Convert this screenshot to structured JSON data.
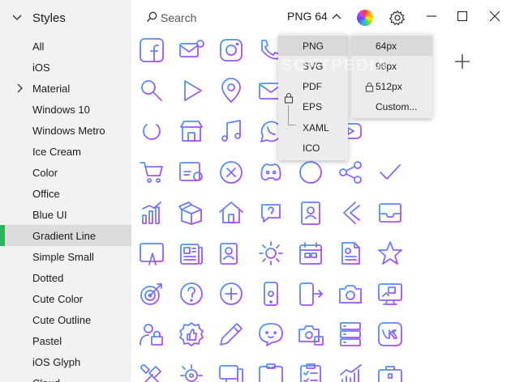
{
  "sidebar": {
    "header": "Styles",
    "items": [
      {
        "label": "All"
      },
      {
        "label": "iOS"
      },
      {
        "label": "Material",
        "expandable": true
      },
      {
        "label": "Windows 10"
      },
      {
        "label": "Windows Metro"
      },
      {
        "label": "Ice Cream"
      },
      {
        "label": "Color"
      },
      {
        "label": "Office"
      },
      {
        "label": "Blue UI"
      },
      {
        "label": "Gradient Line",
        "selected": true
      },
      {
        "label": "Simple Small"
      },
      {
        "label": "Dotted"
      },
      {
        "label": "Cute Color"
      },
      {
        "label": "Cute Outline"
      },
      {
        "label": "Pastel"
      },
      {
        "label": "iOS Glyph"
      },
      {
        "label": "Cloud"
      }
    ]
  },
  "toolbar": {
    "search_placeholder": "Search",
    "format_label": "PNG 64",
    "accent_selected": "#2fb35a"
  },
  "format_menu": {
    "items": [
      "PNG",
      "SVG",
      "PDF",
      "EPS",
      "XAML",
      "ICO"
    ],
    "selected": "PNG",
    "locked_items": [
      "PDF",
      "EPS",
      "XAML"
    ]
  },
  "size_menu": {
    "items": [
      "64px",
      "96px",
      "512px",
      "Custom..."
    ],
    "selected": "64px",
    "locked_items": [
      "512px"
    ]
  },
  "watermark": "SOFTPEDIA",
  "gradient": {
    "from": "#3aa0ff",
    "to": "#c13bff"
  },
  "icons": [
    [
      "facebook-icon",
      "email-icon",
      "instagram-icon",
      "phone-icon",
      "hidden",
      "hidden",
      "hidden"
    ],
    [
      "search-icon",
      "play-icon",
      "location-pin-icon",
      "mail-icon",
      "hidden",
      "hidden",
      "hidden"
    ],
    [
      "power-icon",
      "shop-icon",
      "music-note-icon",
      "whatsapp-icon",
      "hidden",
      "youtube-icon",
      "hidden"
    ],
    [
      "shopping-cart-icon",
      "web-settings-icon",
      "cancel-icon",
      "discord-icon",
      "circle-icon",
      "share-icon",
      "checkmark-icon"
    ],
    [
      "bar-chart-icon",
      "open-box-icon",
      "home-icon",
      "chat-question-icon",
      "id-badge-icon",
      "chevron-left-icon",
      "inbox-icon"
    ],
    [
      "web-design-icon",
      "news-icon",
      "contacts-icon",
      "gear-brain-icon",
      "calendar-icon",
      "document-icon",
      "star-icon"
    ],
    [
      "target-icon",
      "help-icon",
      "add-icon",
      "smartphone-icon",
      "phone-transfer-icon",
      "camera-icon",
      "monitor-icon"
    ],
    [
      "user-lock-icon",
      "like-badge-icon",
      "pencil-icon",
      "cute-chat-icon",
      "photo-icon",
      "server-icon",
      "vk-icon"
    ],
    [
      "tools-icon",
      "settings-flow-icon",
      "computer-icon",
      "book-icon",
      "checklist-icon",
      "stats-icon",
      "briefcase-icon"
    ]
  ]
}
